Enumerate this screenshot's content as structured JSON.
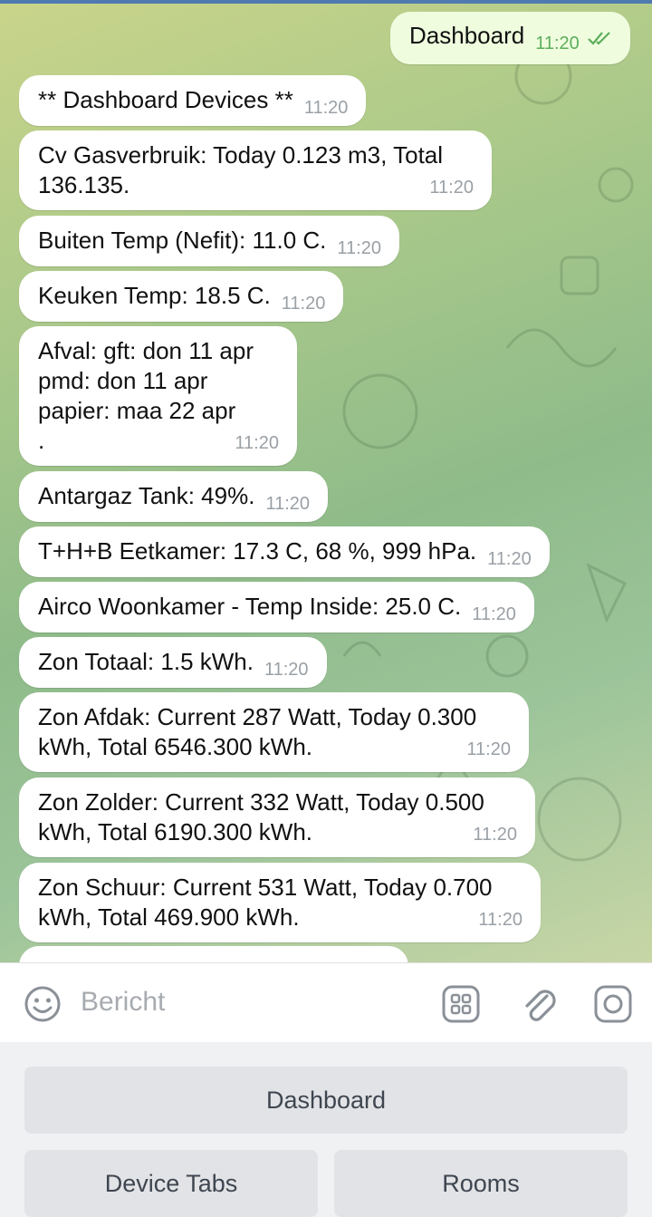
{
  "chat": {
    "outgoing": {
      "text": "Dashboard",
      "time": "11:20"
    },
    "messages": [
      {
        "text": "** Dashboard Devices **",
        "time": "11:20"
      },
      {
        "text": "Cv Gasverbruik: Today 0.123 m3, Total\n136.135.",
        "time": "11:20"
      },
      {
        "text": "Buiten Temp (Nefit): 11.0 C.",
        "time": "11:20"
      },
      {
        "text": "Keuken Temp: 18.5 C.",
        "time": "11:20"
      },
      {
        "text": "Afval: gft: don 11 apr\npmd: don 11 apr\npapier: maa 22 apr\n.",
        "time": "11:20"
      },
      {
        "text": "Antargaz Tank: 49%.",
        "time": "11:20"
      },
      {
        "text": "T+H+B Eetkamer: 17.3 C, 68 %, 999 hPa.",
        "time": "11:20"
      },
      {
        "text": "Airco Woonkamer - Temp Inside: 25.0 C.",
        "time": "11:20"
      },
      {
        "text": "Zon Totaal: 1.5 kWh.",
        "time": "11:20"
      },
      {
        "text": "Zon Afdak: Current 287 Watt, Today 0.300\nkWh, Total 6546.300 kWh.",
        "time": "11:20"
      },
      {
        "text": "Zon Zolder: Current 332 Watt, Today 0.500\nkWh, Total 6190.300 kWh.",
        "time": "11:20"
      },
      {
        "text": "Zon Schuur: Current 531 Watt, Today 0.700\nkWh, Total 469.900 kWh.",
        "time": "11:20"
      }
    ]
  },
  "input": {
    "placeholder": "Bericht"
  },
  "icons": {
    "emoji": "smile-icon",
    "commands": "bot-commands-icon",
    "attach": "paperclip-icon",
    "camera": "camera-icon"
  },
  "keyboard": {
    "row1": [
      "Dashboard"
    ],
    "row2": [
      "Device Tabs",
      "Rooms"
    ]
  },
  "colors": {
    "outgoing_bubble": "#effdde",
    "incoming_bubble": "#ffffff",
    "read_check": "#5cae5c"
  }
}
